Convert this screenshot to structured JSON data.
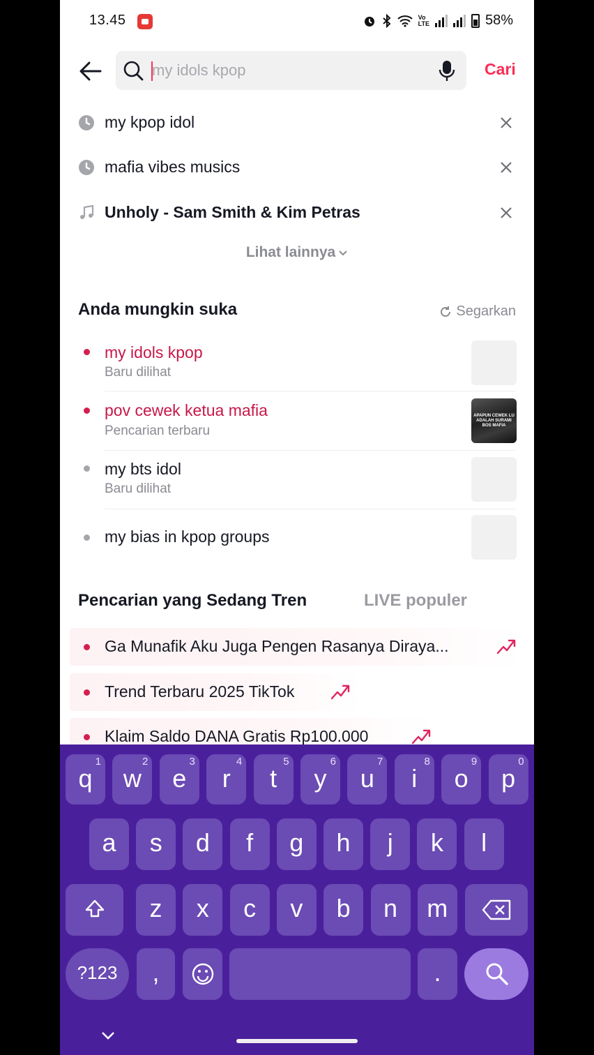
{
  "status": {
    "time": "13.45",
    "battery": "58%"
  },
  "search": {
    "placeholder": "my idols kpop",
    "value": "",
    "submit_label": "Cari"
  },
  "history": [
    {
      "text": "my kpop idol",
      "icon": "clock-icon"
    },
    {
      "text": "mafia vibes musics",
      "icon": "clock-icon"
    },
    {
      "text": "Unholy - Sam Smith & Kim Petras",
      "icon": "music-note-icon"
    }
  ],
  "history_more": "Lihat lainnya",
  "suggestions": {
    "title": "Anda mungkin suka",
    "refresh_label": "Segarkan",
    "items": [
      {
        "text": "my idols kpop",
        "sub": "Baru dilihat",
        "highlight": true
      },
      {
        "text": "pov cewek ketua mafia",
        "sub": "Pencarian terbaru",
        "highlight": true,
        "thumb_caption": "APAPUN CEWEK LU ADALAH SURAMI BOS MAFIA"
      },
      {
        "text": "my bts idol",
        "sub": "Baru dilihat",
        "highlight": false
      },
      {
        "text": "my bias in kpop groups",
        "sub": "",
        "highlight": false
      }
    ]
  },
  "trending": {
    "tab_active": "Pencarian yang Sedang Tren",
    "tab_other": "LIVE populer",
    "items": [
      "Ga Munafik Aku Juga Pengen Rasanya Diraya...",
      "Trend Terbaru 2025 TikTok",
      "Klaim Saldo DANA Gratis Rp100.000"
    ]
  },
  "keyboard": {
    "row1": [
      [
        "q",
        "1"
      ],
      [
        "w",
        "2"
      ],
      [
        "e",
        "3"
      ],
      [
        "r",
        "4"
      ],
      [
        "t",
        "5"
      ],
      [
        "y",
        "6"
      ],
      [
        "u",
        "7"
      ],
      [
        "i",
        "8"
      ],
      [
        "o",
        "9"
      ],
      [
        "p",
        "0"
      ]
    ],
    "row2": [
      "a",
      "s",
      "d",
      "f",
      "g",
      "h",
      "j",
      "k",
      "l"
    ],
    "row3": [
      "z",
      "x",
      "c",
      "v",
      "b",
      "n",
      "m"
    ],
    "symbols_label": "?123",
    "comma": ",",
    "period": "."
  },
  "colors": {
    "accent": "#fe2c55",
    "highlight_text": "#c8174a",
    "keyboard_bg": "#4a1f9c",
    "key_bg": "#6b4bb4"
  }
}
